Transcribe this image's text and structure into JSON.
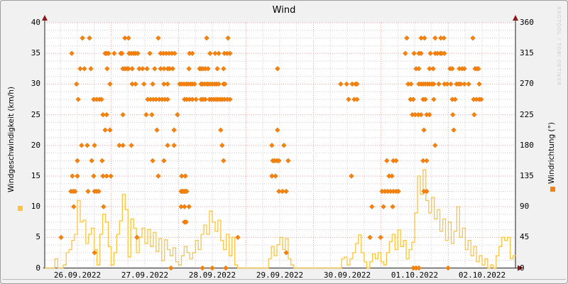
{
  "title": "Wind",
  "watermark": "RRDTOOL / TOBI OETIKER",
  "left_axis": {
    "label": "Windgeschwindigkeit (km/h)",
    "unit": "km/h",
    "ticks": [
      0,
      5,
      10,
      15,
      20,
      25,
      30,
      35,
      40
    ],
    "color": "#fcc33c"
  },
  "right_axis": {
    "label": "Windrichtung (°)",
    "unit": "°",
    "ticks": [
      0,
      45,
      90,
      135,
      180,
      225,
      270,
      315,
      360
    ],
    "color": "#f5820d"
  },
  "x_axis": {
    "labels": [
      "26.09.2022",
      "27.09.2022",
      "28.09.2022",
      "29.09.2022",
      "30.09.2022",
      "01.10.2022",
      "02.10.2022"
    ]
  },
  "chart_data": {
    "type": "line",
    "subtype": "step-line plus diamond scatter, dual y-axis",
    "title": "Wind",
    "xlabel": "",
    "x_unit": "hours since 26.09.2022 00:00",
    "x_range_hours": [
      0,
      168
    ],
    "left_ylabel": "Windgeschwindigkeit (km/h)",
    "left_ylim": [
      0,
      40
    ],
    "right_ylabel": "Windrichtung (°)",
    "right_ylim": [
      0,
      360
    ],
    "grid": {
      "y_major_step_kmh": 5,
      "y_minor_step_kmh": 1.25,
      "x_major_step_h": 24,
      "x_minor_step_h": 6
    },
    "series": [
      {
        "name": "Windgeschwindigkeit",
        "type": "step-line",
        "unit": "km/h",
        "color": "#fcc33c",
        "x_start_hour": 0,
        "x_step_hours": 1,
        "values": [
          0,
          0,
          0,
          0,
          1.5,
          0,
          0,
          0.5,
          2.5,
          3,
          4.5,
          5.5,
          11,
          7.5,
          7.8,
          4,
          5.5,
          6.5,
          3,
          0.5,
          5.5,
          8.8,
          7.5,
          3.5,
          0.5,
          2.5,
          5.5,
          7.7,
          12,
          9.5,
          1.8,
          8,
          6.5,
          2.5,
          5,
          6.5,
          4,
          6.3,
          3.5,
          5.8,
          2.7,
          4.8,
          1.2,
          4.6,
          3,
          2,
          3.3,
          1,
          0.5,
          2,
          3.5,
          2.5,
          1.5,
          2.5,
          4.5,
          3,
          5.5,
          7,
          5.5,
          9.3,
          7.5,
          6,
          7.8,
          4.5,
          3,
          5.5,
          2,
          5,
          0.5,
          0,
          0,
          0,
          0,
          0,
          0,
          0,
          0,
          0,
          0,
          0,
          1.5,
          3.5,
          2,
          3.8,
          5,
          3,
          4.8,
          1.5,
          0.5,
          0,
          0,
          0,
          0,
          0,
          0,
          0,
          0,
          0,
          0,
          0,
          0,
          0,
          0,
          0,
          0,
          0,
          1.5,
          1.8,
          0.5,
          1.5,
          2.5,
          4,
          5.4,
          2.5,
          1,
          0,
          1,
          2.3,
          1.5,
          2.5,
          1,
          0.5,
          2.5,
          4.3,
          5.5,
          3,
          6.2,
          3.5,
          4.5,
          1.5,
          3,
          4.2,
          9,
          15,
          12,
          16,
          11,
          9,
          11.5,
          8,
          9.5,
          6,
          8,
          4.5,
          7.5,
          4,
          6,
          10,
          5,
          6.5,
          3,
          4.5,
          2,
          3.5,
          1,
          2,
          0.5,
          1.5,
          0,
          0.5,
          0,
          2,
          3.5,
          5,
          4.5,
          5,
          1.5,
          2
        ]
      },
      {
        "name": "Windrichtung",
        "type": "scatter",
        "unit": "°",
        "color": "#f5820d",
        "marker": "diamond",
        "points_by_direction": {
          "337.5": [
            13.8,
            16.3,
            28.9,
            30.2,
            40.8,
            58,
            65.6,
            129.2,
            134.3,
            135.5,
            139.3,
            141.3,
            142.4,
            152.7
          ],
          "315": [
            10,
            21.9,
            22.4,
            23.1,
            25.1,
            27.4,
            27.9,
            30.4,
            31.2,
            32,
            32.7,
            33.5,
            37.8,
            41.6,
            42.6,
            43.6,
            44.6,
            45.6,
            46.6,
            51.9,
            52.9,
            59.2,
            61,
            62.3,
            64.3,
            65.3,
            66.3,
            128.7,
            131.8,
            133.5,
            134.3,
            137.6,
            139.3,
            140.1,
            141.1,
            141.6,
            142.6
          ],
          "292.5": [
            13,
            14.5,
            16.8,
            22.6,
            28.2,
            28.9,
            29.7,
            30.2,
            31.5,
            34,
            35.2,
            36.8,
            39.5,
            41.6,
            42.8,
            44.1,
            44.8,
            45.9,
            51.7,
            55.5,
            56,
            56.7,
            57.5,
            58.5,
            61.8,
            64,
            83.2,
            132.5,
            133.5,
            137.3,
            138.6,
            144.6,
            145.4,
            147.9,
            148.9,
            149.7,
            153.5,
            154.2,
            154.7
          ],
          "270": [
            11.7,
            23.6,
            31.5,
            32.7,
            35.7,
            38.8,
            42.8,
            44.1,
            48.4,
            49.1,
            49.9,
            50.7,
            51.4,
            52.2,
            52.9,
            53.7,
            56,
            56.5,
            57.2,
            58,
            58.5,
            59.2,
            60,
            60.8,
            61.5,
            62.3,
            64,
            64.5,
            105.7,
            107.8,
            109.8,
            111,
            111.5,
            129.7,
            130.7,
            133.5,
            134.3,
            135,
            135.8,
            136.6,
            137.3,
            138.1,
            138.8,
            140.6,
            142.6,
            143.6,
            144.9,
            146.9,
            147.7,
            148.4,
            149.7,
            151.2,
            155
          ],
          "247.5": [
            12.3,
            17.8,
            18.8,
            19.8,
            20.6,
            37,
            38,
            39,
            40,
            41.1,
            42.1,
            43.1,
            44.1,
            50.1,
            50.9,
            51.9,
            52.9,
            54.2,
            56,
            56.7,
            57.5,
            59,
            59.7,
            60.5,
            61.3,
            62,
            62.8,
            63.5,
            64.3,
            65.3,
            66.3,
            108.5,
            110.5,
            111.5,
            130.5,
            131.5,
            135,
            135.8,
            138.8,
            145.4,
            146.4,
            153,
            154,
            155,
            155.7
          ],
          "225": [
            21.1,
            22.4,
            28.2,
            36.5,
            38.5,
            47.6,
            131.2,
            132.2,
            133.3,
            134.3,
            136.3,
            137.3,
            145.6,
            153.2
          ],
          "202.5": [
            21.9,
            23.6,
            40.3,
            46.4,
            63,
            83.2,
            135.3,
            145.9
          ],
          "180": [
            13.5,
            15.5,
            18.1,
            26.9,
            28.2,
            31.2,
            44.1,
            46.4,
            63.5,
            81.2,
            85.5,
            139.3
          ],
          "157.5": [
            12,
            17.1,
            20.8,
            38.8,
            42.8,
            64,
            81.5,
            82.2,
            83,
            83.7,
            87,
            122.1,
            124.4,
            125.4,
            135,
            136.3
          ],
          "135": [
            10.2,
            12,
            17.8,
            21.1,
            22.4,
            23.9,
            40.8,
            49.1,
            50.4,
            81.2,
            82.5,
            109.5,
            122.9,
            123.9
          ],
          "112.5": [
            9.7,
            10.5,
            11.2,
            15.8,
            18.1,
            18.8,
            19.6,
            48.9,
            49.4,
            49.9,
            50.4,
            50.9,
            83.7,
            85,
            86.3,
            120.4,
            121.4,
            122.4,
            123.4,
            124.4,
            125.4,
            126.2,
            135.3,
            136.3
          ],
          "90": [
            10.7,
            21.3,
            48.9,
            50.1,
            51.7,
            116.8,
            120.9,
            124.2
          ],
          "67.5": [
            50.1,
            50.7
          ],
          "45": [
            6.2,
            33.2,
            69.1,
            116.1,
            119.9
          ],
          "22.5": [
            18.1,
            86.3
          ],
          "0": [
            45.3,
            56.5,
            60,
            64.8,
            131.5,
            132.5,
            133.5,
            143.9
          ]
        }
      }
    ]
  },
  "style": {
    "plot_background": "#ffffff",
    "outer_background": "#f1f1f1",
    "grid_major_color": "#eda3a3",
    "grid_minor_color": "#cdcdcd",
    "axis_color": "#444444",
    "arrow_color": "#8b1a1a"
  }
}
